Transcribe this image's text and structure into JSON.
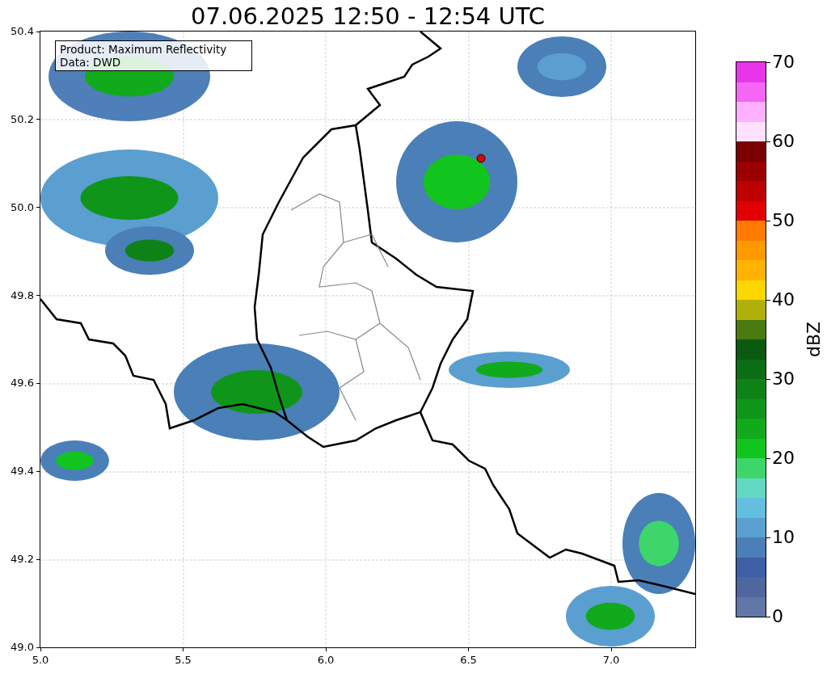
{
  "title": "07.06.2025 12:50 - 12:54 UTC",
  "legend": {
    "lines": [
      "Product: Maximum Reflectivity",
      "Data: DWD"
    ]
  },
  "x_ticks": [
    "5.0",
    "5.5",
    "6.0",
    "6.5",
    "7.0"
  ],
  "y_ticks": [
    "50.4",
    "50.2",
    "50.0",
    "49.8",
    "49.6",
    "49.4",
    "49.2",
    "49.0"
  ],
  "colorbar": {
    "label": "dBZ",
    "ticks": [
      "70",
      "60",
      "50",
      "40",
      "30",
      "20",
      "10",
      "0"
    ],
    "segments": [
      {
        "color": "#e935e9"
      },
      {
        "color": "#f666f6"
      },
      {
        "color": "#ffb0ff"
      },
      {
        "color": "#ffe0ff"
      },
      {
        "color": "#7a0000"
      },
      {
        "color": "#9b0000"
      },
      {
        "color": "#bd0000"
      },
      {
        "color": "#e00000"
      },
      {
        "color": "#ff7b00"
      },
      {
        "color": "#ff9900"
      },
      {
        "color": "#ffb300"
      },
      {
        "color": "#ffd700"
      },
      {
        "color": "#b0b00a"
      },
      {
        "color": "#4a7a10"
      },
      {
        "color": "#0a5a10"
      },
      {
        "color": "#0c6e14"
      },
      {
        "color": "#0e8217"
      },
      {
        "color": "#0f961a"
      },
      {
        "color": "#10aa1c"
      },
      {
        "color": "#12c51e"
      },
      {
        "color": "#3dd66a"
      },
      {
        "color": "#63d9c4"
      },
      {
        "color": "#63bfe0"
      },
      {
        "color": "#5a9fcf"
      },
      {
        "color": "#4a7fb8"
      },
      {
        "color": "#3e5fa5"
      },
      {
        "color": "#4f669f"
      },
      {
        "color": "#6276a8"
      }
    ]
  }
}
